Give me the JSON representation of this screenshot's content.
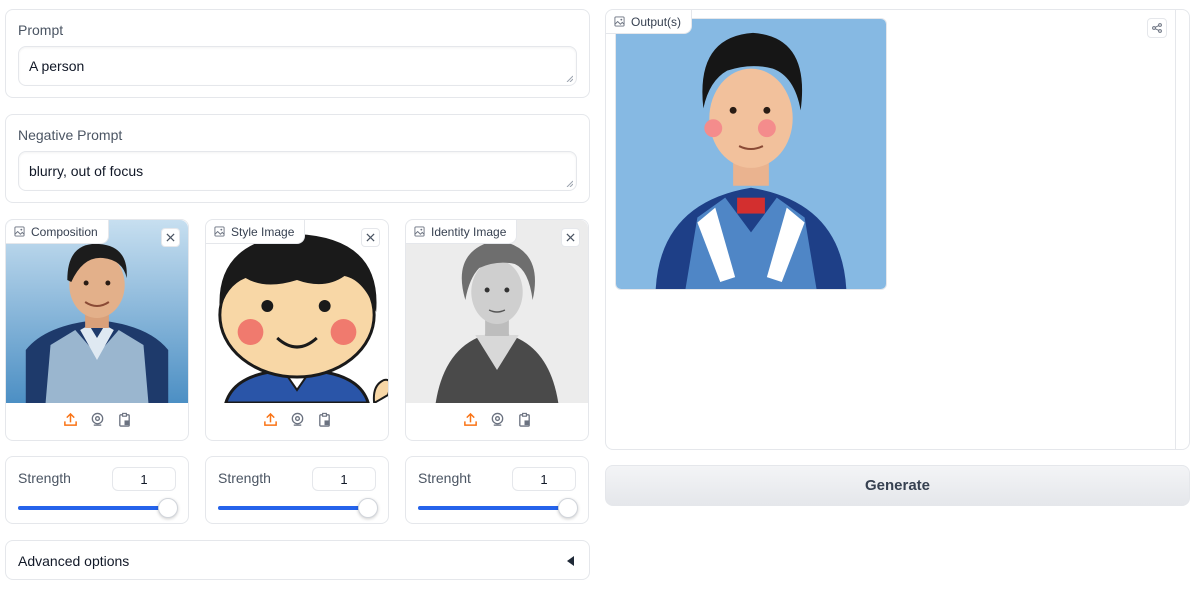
{
  "prompt": {
    "label": "Prompt",
    "value": "A person"
  },
  "negative_prompt": {
    "label": "Negative Prompt",
    "value": "blurry, out of focus"
  },
  "images": [
    {
      "label": "Composition",
      "icon": "image-icon"
    },
    {
      "label": "Style Image",
      "icon": "image-icon"
    },
    {
      "label": "Identity Image",
      "icon": "image-icon"
    }
  ],
  "image_sources": [
    "upload-icon",
    "webcam-icon",
    "clipboard-icon"
  ],
  "sliders": [
    {
      "label": "Strength",
      "value": "1",
      "fill": 0.95
    },
    {
      "label": "Strength",
      "value": "1",
      "fill": 0.95
    },
    {
      "label": "Strenght",
      "value": "1",
      "fill": 0.95
    }
  ],
  "advanced": {
    "label": "Advanced options"
  },
  "output": {
    "label": "Output(s)"
  },
  "generate": {
    "label": "Generate"
  },
  "colors": {
    "accent": "#2563eb",
    "upload": "#f97316",
    "border": "#e5e7eb"
  }
}
